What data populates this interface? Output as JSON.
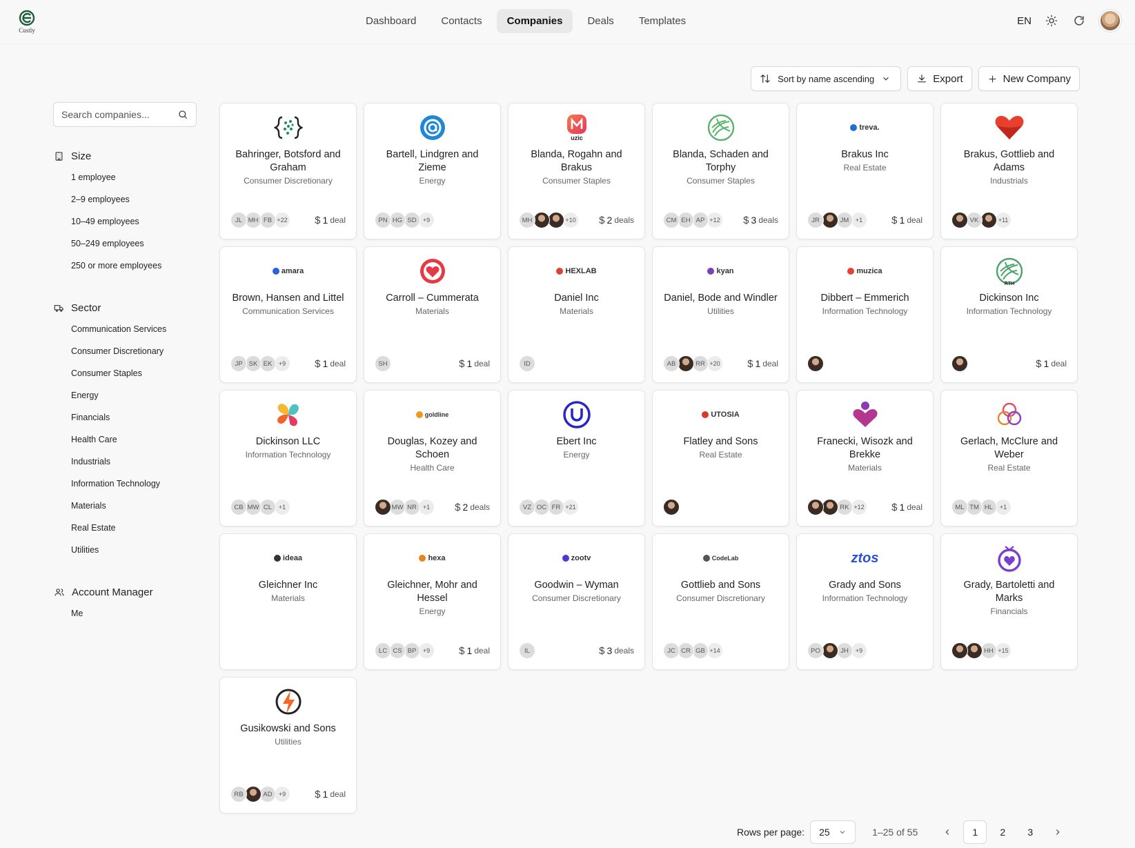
{
  "app": {
    "logo_text": "Custly"
  },
  "nav": {
    "items": [
      {
        "label": "Dashboard"
      },
      {
        "label": "Contacts"
      },
      {
        "label": "Companies",
        "active": true
      },
      {
        "label": "Deals"
      },
      {
        "label": "Templates"
      }
    ],
    "language": "EN"
  },
  "toolbar": {
    "sort_label": "Sort by name ascending",
    "export_label": "Export",
    "new_label": "New Company"
  },
  "search": {
    "placeholder": "Search companies..."
  },
  "filters": {
    "size": {
      "title": "Size",
      "items": [
        "1 employee",
        "2–9 employees",
        "10–49 employees",
        "50–249 employees",
        "250 or more employees"
      ]
    },
    "sector": {
      "title": "Sector",
      "items": [
        "Communication Services",
        "Consumer Discretionary",
        "Consumer Staples",
        "Energy",
        "Financials",
        "Health Care",
        "Industrials",
        "Information Technology",
        "Materials",
        "Real Estate",
        "Utilities"
      ]
    },
    "account_manager": {
      "title": "Account Manager",
      "items": [
        "Me"
      ]
    }
  },
  "companies": [
    {
      "name": "Bahringer, Botsford and Graham",
      "sector": "Consumer Discretionary",
      "logo": "braces-dots",
      "logo_color": "#1f8a6e",
      "avatars": [
        "JL",
        "MH",
        "FB"
      ],
      "more": "+22",
      "deal_count": "1",
      "deal_word": "deal"
    },
    {
      "name": "Bartell, Lindgren and Zieme",
      "sector": "Energy",
      "logo": "ring-a",
      "logo_color": "#1e88d6",
      "avatars": [
        "PN",
        "HG",
        "SD"
      ],
      "more": "+9",
      "deal_count": "",
      "deal_word": ""
    },
    {
      "name": "Blanda, Rogahn and Brakus",
      "sector": "Consumer Staples",
      "logo": "muzic",
      "logo_color": "#ef4a5e",
      "logo_text": "uzic",
      "avatars": [
        "MH",
        "@photo",
        "@photo"
      ],
      "more": "+10",
      "deal_count": "2",
      "deal_word": "deals"
    },
    {
      "name": "Blanda, Schaden and Torphy",
      "sector": "Consumer Staples",
      "logo": "leaf-circle",
      "logo_color": "#58b36c",
      "avatars": [
        "CM",
        "EH",
        "AP"
      ],
      "more": "+12",
      "deal_count": "3",
      "deal_word": "deals"
    },
    {
      "name": "Brakus Inc",
      "sector": "Real Estate",
      "logo": "wordmark",
      "logo_color": "#1d6fcf",
      "logo_text": "treva.",
      "avatars": [
        "JR",
        "@photo",
        "JM"
      ],
      "more": "+1",
      "deal_count": "1",
      "deal_word": "deal"
    },
    {
      "name": "Brakus, Gottlieb and Adams",
      "sector": "Industrials",
      "logo": "heart",
      "logo_color": "#e7402f",
      "avatars": [
        "@photo",
        "VK",
        "@photo"
      ],
      "more": "+11",
      "deal_count": "",
      "deal_word": ""
    },
    {
      "name": "Brown, Hansen and Littel",
      "sector": "Communication Services",
      "logo": "wordmark",
      "logo_color": "#2a63d8",
      "logo_text": "amara",
      "avatars": [
        "JP",
        "SK",
        "EK"
      ],
      "more": "+9",
      "deal_count": "1",
      "deal_word": "deal"
    },
    {
      "name": "Carroll – Cummerata",
      "sector": "Materials",
      "logo": "heart-circle",
      "logo_color": "#e53945",
      "avatars": [
        "SH"
      ],
      "more": "",
      "deal_count": "1",
      "deal_word": "deal"
    },
    {
      "name": "Daniel Inc",
      "sector": "Materials",
      "logo": "wordmark",
      "logo_color": "#d6452f",
      "logo_text": "HEXLAB",
      "avatars": [
        "ID"
      ],
      "more": "",
      "deal_count": "",
      "deal_word": ""
    },
    {
      "name": "Daniel, Bode and Windler",
      "sector": "Utilities",
      "logo": "wordmark",
      "logo_color": "#7b3fb8",
      "logo_text": "kyan",
      "avatars": [
        "AB",
        "@photo",
        "RR"
      ],
      "more": "+20",
      "deal_count": "1",
      "deal_word": "deal"
    },
    {
      "name": "Dibbert – Emmerich",
      "sector": "Information Technology",
      "logo": "wordmark",
      "logo_color": "#e4432f",
      "logo_text": "muzica",
      "avatars": [
        "@photo"
      ],
      "more": "",
      "deal_count": "",
      "deal_word": ""
    },
    {
      "name": "Dickinson Inc",
      "sector": "Information Technology",
      "logo": "leaf-circle",
      "logo_color": "#4aa36b",
      "logo_text": "RTH",
      "avatars": [
        "@photo"
      ],
      "more": "",
      "deal_count": "1",
      "deal_word": "deal"
    },
    {
      "name": "Dickinson LLC",
      "sector": "Information Technology",
      "logo": "petals",
      "logo_color": "#f0652b",
      "avatars": [
        "CB",
        "MW",
        "CL"
      ],
      "more": "+1",
      "deal_count": "",
      "deal_word": ""
    },
    {
      "name": "Douglas, Kozey and Schoen",
      "sector": "Health Care",
      "logo": "wordmark",
      "logo_color": "#e99a1f",
      "logo_text": "goldline",
      "avatars": [
        "@photo",
        "MW",
        "NR"
      ],
      "more": "+1",
      "deal_count": "2",
      "deal_word": "deals"
    },
    {
      "name": "Ebert Inc",
      "sector": "Energy",
      "logo": "u-circle",
      "logo_color": "#2727c9",
      "avatars": [
        "VZ",
        "OC",
        "FR"
      ],
      "more": "+21",
      "deal_count": "",
      "deal_word": ""
    },
    {
      "name": "Flatley and Sons",
      "sector": "Real Estate",
      "logo": "wordmark",
      "logo_color": "#d23c2c",
      "logo_text": "UTOSIA",
      "avatars": [
        "@photo"
      ],
      "more": "",
      "deal_count": "",
      "deal_word": ""
    },
    {
      "name": "Franecki, Wisozk and Brekke",
      "sector": "Materials",
      "logo": "person-heart",
      "logo_color": "#b3368f",
      "avatars": [
        "@photo",
        "@photo",
        "RK"
      ],
      "more": "+12",
      "deal_count": "1",
      "deal_word": "deal"
    },
    {
      "name": "Gerlach, McClure and Weber",
      "sector": "Real Estate",
      "logo": "knot",
      "logo_color": "#d23a6a",
      "avatars": [
        "ML",
        "TM",
        "HL"
      ],
      "more": "+1",
      "deal_count": "",
      "deal_word": ""
    },
    {
      "name": "Gleichner Inc",
      "sector": "Materials",
      "logo": "wordmark",
      "logo_color": "#333333",
      "logo_text": "ideaa",
      "avatars": [],
      "more": "",
      "deal_count": "",
      "deal_word": ""
    },
    {
      "name": "Gleichner, Mohr and Hessel",
      "sector": "Energy",
      "logo": "wordmark",
      "logo_color": "#e6841e",
      "logo_text": "hexa",
      "avatars": [
        "LC",
        "CS",
        "BP"
      ],
      "more": "+9",
      "deal_count": "1",
      "deal_word": "deal"
    },
    {
      "name": "Goodwin – Wyman",
      "sector": "Consumer Discretionary",
      "logo": "wordmark",
      "logo_color": "#4b3ccf",
      "logo_text": "zootv",
      "avatars": [
        "IL"
      ],
      "more": "",
      "deal_count": "3",
      "deal_word": "deals"
    },
    {
      "name": "Gottlieb and Sons",
      "sector": "Consumer Discretionary",
      "logo": "wordmark",
      "logo_color": "#555555",
      "logo_text": "CodeLab",
      "avatars": [
        "JC",
        "CR",
        "GB"
      ],
      "more": "+14",
      "deal_count": "",
      "deal_word": ""
    },
    {
      "name": "Grady and Sons",
      "sector": "Information Technology",
      "logo": "ztos",
      "logo_color": "#2b52d4",
      "logo_text": "ztos",
      "avatars": [
        "PO",
        "@photo",
        "JH"
      ],
      "more": "+9",
      "deal_count": "",
      "deal_word": ""
    },
    {
      "name": "Grady, Bartoletti and Marks",
      "sector": "Financials",
      "logo": "tv-heart",
      "logo_color": "#7b3fd0",
      "avatars": [
        "@photo",
        "@photo",
        "HH"
      ],
      "more": "+15",
      "deal_count": "",
      "deal_word": ""
    },
    {
      "name": "Gusikowski and Sons",
      "sector": "Utilities",
      "logo": "bolt-circle",
      "logo_color": "#f06a27",
      "avatars": [
        "RB",
        "@photo",
        "AD"
      ],
      "more": "+9",
      "deal_count": "1",
      "deal_word": "deal"
    }
  ],
  "pagination": {
    "rows_label": "Rows per page:",
    "rows_value": "25",
    "range": "1–25 of 55",
    "pages": [
      "1",
      "2",
      "3"
    ],
    "current": "1"
  }
}
